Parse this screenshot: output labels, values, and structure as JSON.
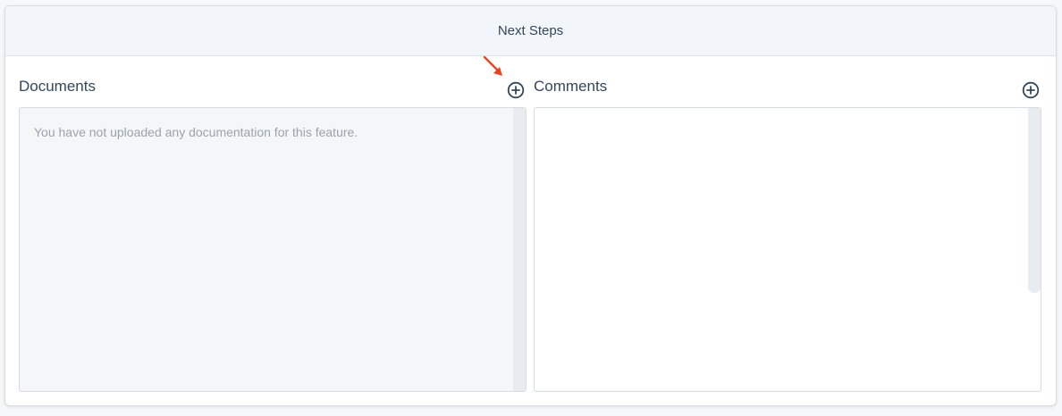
{
  "header": {
    "title": "Next Steps"
  },
  "documents": {
    "title": "Documents",
    "add_icon": "plus-circle-icon",
    "empty_message": "You have not uploaded any documentation for this feature."
  },
  "comments": {
    "title": "Comments",
    "add_icon": "plus-circle-icon"
  },
  "annotation": {
    "icon": "arrow-icon",
    "color": "#e8431f"
  },
  "colors": {
    "text": "#33475b",
    "muted_text": "#9aa3ad",
    "header_bg": "#f2f6fa",
    "documents_panel_bg": "#f5f6f8",
    "comments_panel_bg": "#ffffff"
  }
}
